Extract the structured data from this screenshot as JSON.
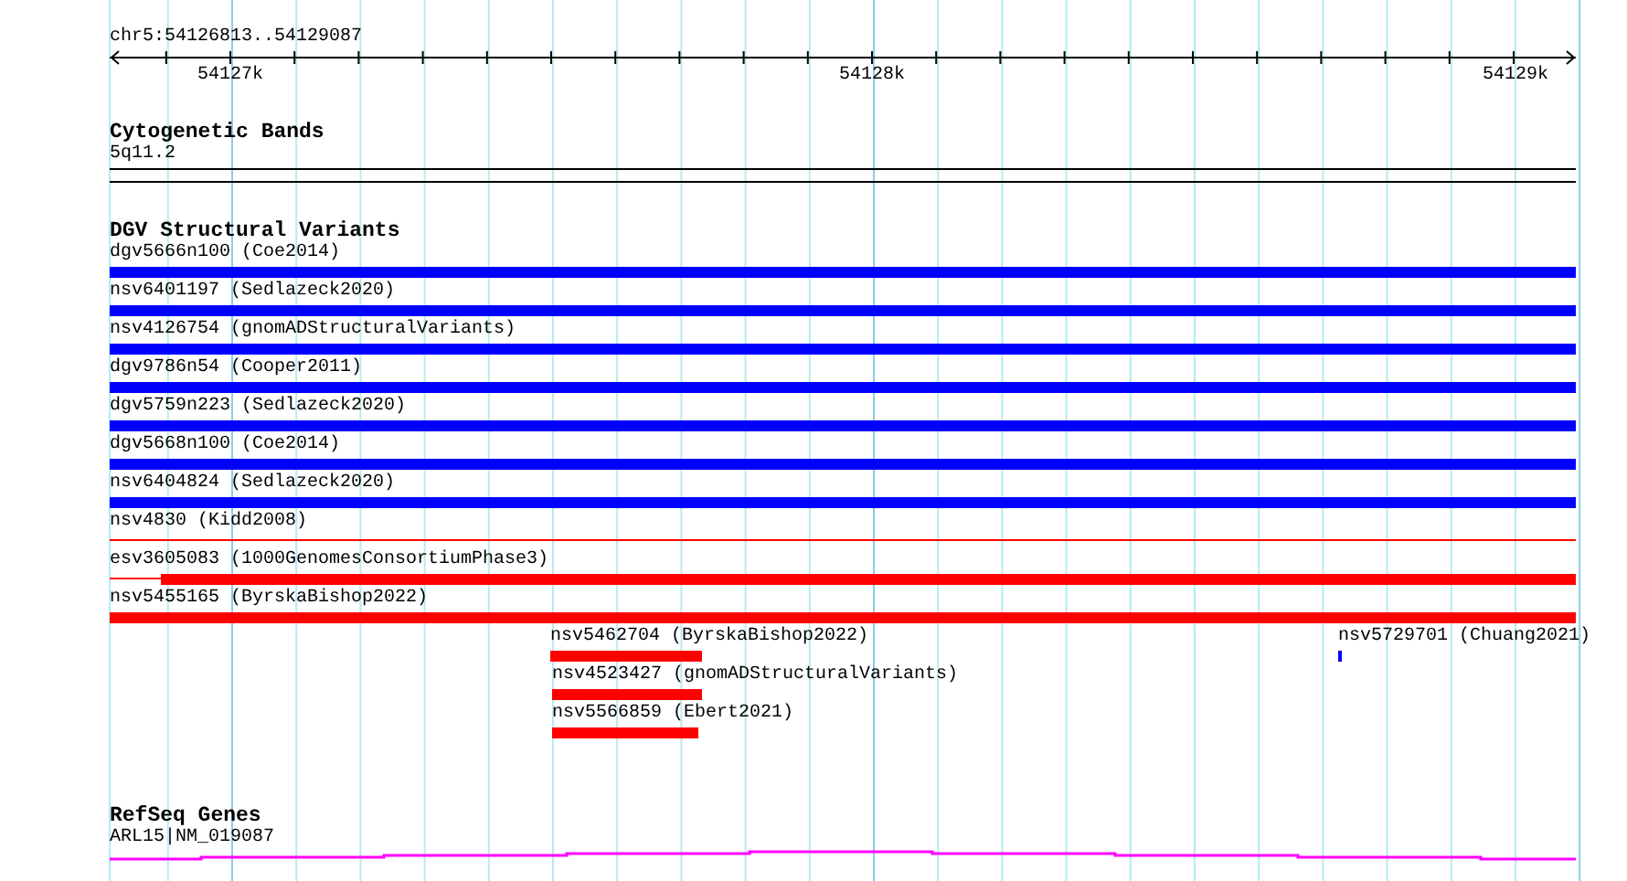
{
  "ruler": {
    "location": "chr5:54126813..54129087",
    "ticks": [
      "54127k",
      "54128k",
      "54129k"
    ]
  },
  "tracks": [
    {
      "kind": "bands",
      "title": "Cytogenetic Bands",
      "features": [
        {
          "label": "5q11.2"
        }
      ]
    },
    {
      "kind": "variants",
      "title": "DGV Structural Variants",
      "features": [
        {
          "label": "dgv5666n100 (Coe2014)",
          "color": "#0000ff"
        },
        {
          "label": "nsv6401197 (Sedlazeck2020)",
          "color": "#0000ff"
        },
        {
          "label": "nsv4126754 (gnomADStructuralVariants)",
          "color": "#0000ff"
        },
        {
          "label": "dgv9786n54 (Cooper2011)",
          "color": "#0000ff"
        },
        {
          "label": "dgv5759n223 (Sedlazeck2020)",
          "color": "#0000ff"
        },
        {
          "label": "dgv5668n100 (Coe2014)",
          "color": "#0000ff"
        },
        {
          "label": "nsv6404824 (Sedlazeck2020)",
          "color": "#0000ff"
        },
        {
          "label": "nsv4830 (Kidd2008)",
          "color": "#ff0000"
        },
        {
          "label": "esv3605083 (1000GenomesConsortiumPhase3)",
          "color": "#ff0000"
        },
        {
          "label": "nsv5455165 (ByrskaBishop2022)",
          "color": "#ff0000"
        },
        {
          "label": "nsv5462704 (ByrskaBishop2022)",
          "color": "#ff0000"
        },
        {
          "label": "nsv5729701 (Chuang2021)",
          "color": "#0000ff"
        },
        {
          "label": "nsv4523427 (gnomADStructuralVariants)",
          "color": "#ff0000"
        },
        {
          "label": "nsv5566859 (Ebert2021)",
          "color": "#ff0000"
        }
      ]
    },
    {
      "kind": "genes",
      "title": "RefSeq Genes",
      "features": [
        {
          "label": "ARL15|NM_019087",
          "color": "#ff00ff"
        }
      ]
    }
  ]
}
